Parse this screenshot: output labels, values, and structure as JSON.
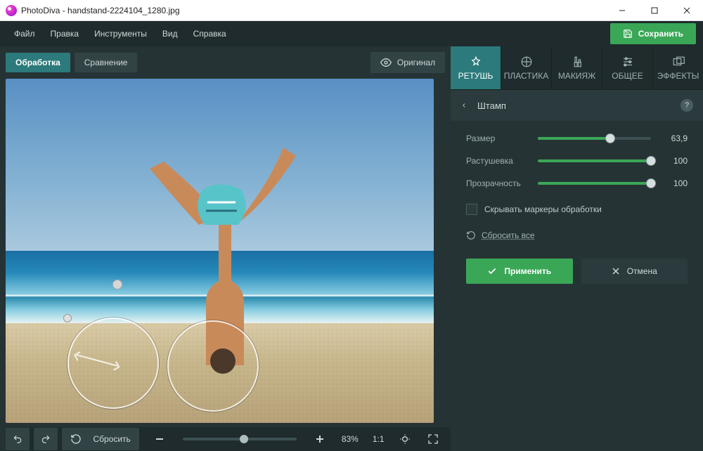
{
  "window": {
    "title": "PhotoDiva - handstand-2224104_1280.jpg"
  },
  "menu": {
    "file": "Файл",
    "edit": "Правка",
    "tools": "Инструменты",
    "view": "Вид",
    "help": "Справка"
  },
  "save_label": "Сохранить",
  "left_tabs": {
    "edit": "Обработка",
    "compare": "Сравнение",
    "original": "Оригинал"
  },
  "bottom": {
    "reset": "Сбросить",
    "zoom_percent": 50,
    "zoom_label": "83%",
    "onetoone": "1:1"
  },
  "tool_tabs": {
    "retouch": "РЕТУШЬ",
    "plastic": "ПЛАСТИКА",
    "makeup": "МАКИЯЖ",
    "general": "ОБЩЕЕ",
    "effects": "ЭФФЕКТЫ"
  },
  "panel": {
    "title": "Штамп",
    "sliders": {
      "size": {
        "label": "Размер",
        "value": "63,9",
        "percent": 63.9
      },
      "feather": {
        "label": "Растушевка",
        "value": "100",
        "percent": 100
      },
      "opacity": {
        "label": "Прозрачность",
        "value": "100",
        "percent": 100
      }
    },
    "hide_markers": "Скрывать маркеры обработки",
    "reset_all": "Сбросить все",
    "apply": "Применить",
    "cancel": "Отмена"
  }
}
